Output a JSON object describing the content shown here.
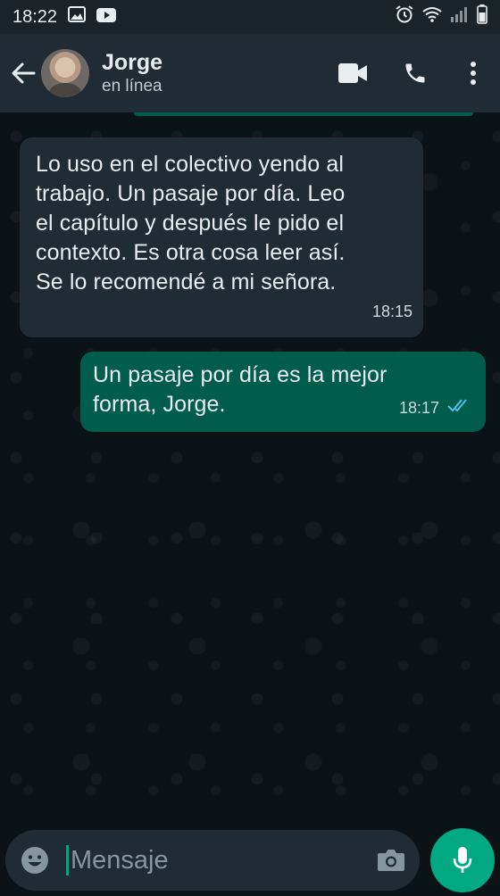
{
  "status_bar": {
    "time": "18:22"
  },
  "header": {
    "contact_name": "Jorge",
    "contact_status": "en línea"
  },
  "messages": [
    {
      "direction": "incoming",
      "text": "Lo uso en el colectivo yendo al\ntrabajo. Un pasaje por día. Leo\nel capítulo y después le pido el\ncontexto. Es otra cosa leer así.\nSe lo recomendé a mi señora.",
      "time": "18:15"
    },
    {
      "direction": "outgoing",
      "text": "Un pasaje por día es la mejor\nforma, Jorge.",
      "time": "18:17",
      "status": "read"
    }
  ],
  "composer": {
    "placeholder": "Mensaje"
  },
  "icons": {
    "back": "arrow-left-icon",
    "video_call": "video-camera-icon",
    "voice_call": "phone-icon",
    "menu": "more-vertical-icon",
    "emoji": "emoji-icon",
    "camera": "camera-icon",
    "mic": "microphone-icon",
    "read_receipt": "double-check-icon"
  },
  "colors": {
    "header_bg": "#1f2c34",
    "incoming_bubble": "#1f2c34",
    "outgoing_bubble": "#005c4b",
    "accent": "#00a884",
    "read_tick": "#53bdeb"
  }
}
